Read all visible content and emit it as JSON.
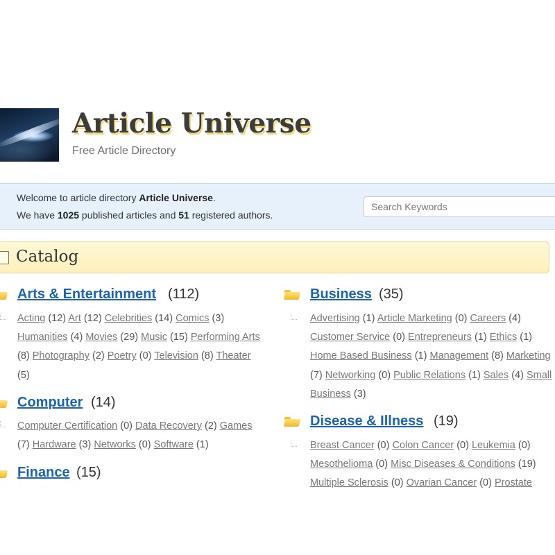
{
  "header": {
    "site_title": "Article Universe",
    "site_subtitle": "Free Article Directory"
  },
  "welcome": {
    "line1_prefix": "Welcome to article directory ",
    "line1_bold": "Article Universe",
    "line1_suffix": ".",
    "line2_prefix": "We have ",
    "article_count": "1025",
    "line2_mid": " published articles and ",
    "author_count": "51",
    "line2_suffix": " registered authors."
  },
  "search": {
    "placeholder": "Search Keywords"
  },
  "catalog": {
    "title": "Catalog"
  },
  "categories": {
    "arts": {
      "name": "Arts & Entertainment",
      "count": "(112)",
      "subs": [
        {
          "label": "Acting",
          "count": "(12)"
        },
        {
          "label": "Art",
          "count": "(12)"
        },
        {
          "label": "Celebrities",
          "count": "(14)"
        },
        {
          "label": "Comics",
          "count": "(3)"
        },
        {
          "label": "Humanities",
          "count": "(4)"
        },
        {
          "label": "Movies",
          "count": "(29)"
        },
        {
          "label": "Music",
          "count": "(15)"
        },
        {
          "label": "Performing Arts",
          "count": "(8)"
        },
        {
          "label": "Photography",
          "count": "(2)"
        },
        {
          "label": "Poetry",
          "count": "(0)"
        },
        {
          "label": "Television",
          "count": "(8)"
        },
        {
          "label": "Theater",
          "count": "(5)"
        }
      ]
    },
    "computer": {
      "name": "Computer",
      "count": "(14)",
      "subs": [
        {
          "label": "Computer Certification",
          "count": "(0)"
        },
        {
          "label": "Data Recovery",
          "count": "(2)"
        },
        {
          "label": "Games",
          "count": "(7)"
        },
        {
          "label": "Hardware",
          "count": "(3)"
        },
        {
          "label": "Networks",
          "count": "(0)"
        },
        {
          "label": "Software",
          "count": "(1)"
        }
      ]
    },
    "finance": {
      "name": "Finance",
      "count": "(15)"
    },
    "business": {
      "name": "Business",
      "count": "(35)",
      "subs": [
        {
          "label": "Advertising",
          "count": "(1)"
        },
        {
          "label": "Article Marketing",
          "count": "(0)"
        },
        {
          "label": "Careers",
          "count": "(4)"
        },
        {
          "label": "Customer Service",
          "count": "(0)"
        },
        {
          "label": "Entrepreneurs",
          "count": "(1)"
        },
        {
          "label": "Ethics",
          "count": "(1)"
        },
        {
          "label": "Home Based Business",
          "count": "(1)"
        },
        {
          "label": "Management",
          "count": "(8)"
        },
        {
          "label": "Marketing",
          "count": "(7)"
        },
        {
          "label": "Networking",
          "count": "(0)"
        },
        {
          "label": "Public Relations",
          "count": "(1)"
        },
        {
          "label": "Sales",
          "count": "(4)"
        },
        {
          "label": "Small Business",
          "count": "(3)"
        }
      ]
    },
    "disease": {
      "name": "Disease & Illness",
      "count": "(19)",
      "subs": [
        {
          "label": "Breast Cancer",
          "count": "(0)"
        },
        {
          "label": "Colon Cancer",
          "count": "(0)"
        },
        {
          "label": "Leukemia",
          "count": "(0)"
        },
        {
          "label": "Mesothelioma",
          "count": "(0)"
        },
        {
          "label": "Misc Diseases & Conditions",
          "count": "(19)"
        },
        {
          "label": "Multiple Sclerosis",
          "count": "(0)"
        },
        {
          "label": "Ovarian Cancer",
          "count": "(0)"
        },
        {
          "label": "Prostate",
          "count": ""
        }
      ]
    }
  },
  "colors": {
    "category_link": "#1a63b5",
    "welcome_bg": "#e6f1fc",
    "catalog_bg": "#fdf0bb",
    "title_shadow": "#f2dc7a"
  }
}
